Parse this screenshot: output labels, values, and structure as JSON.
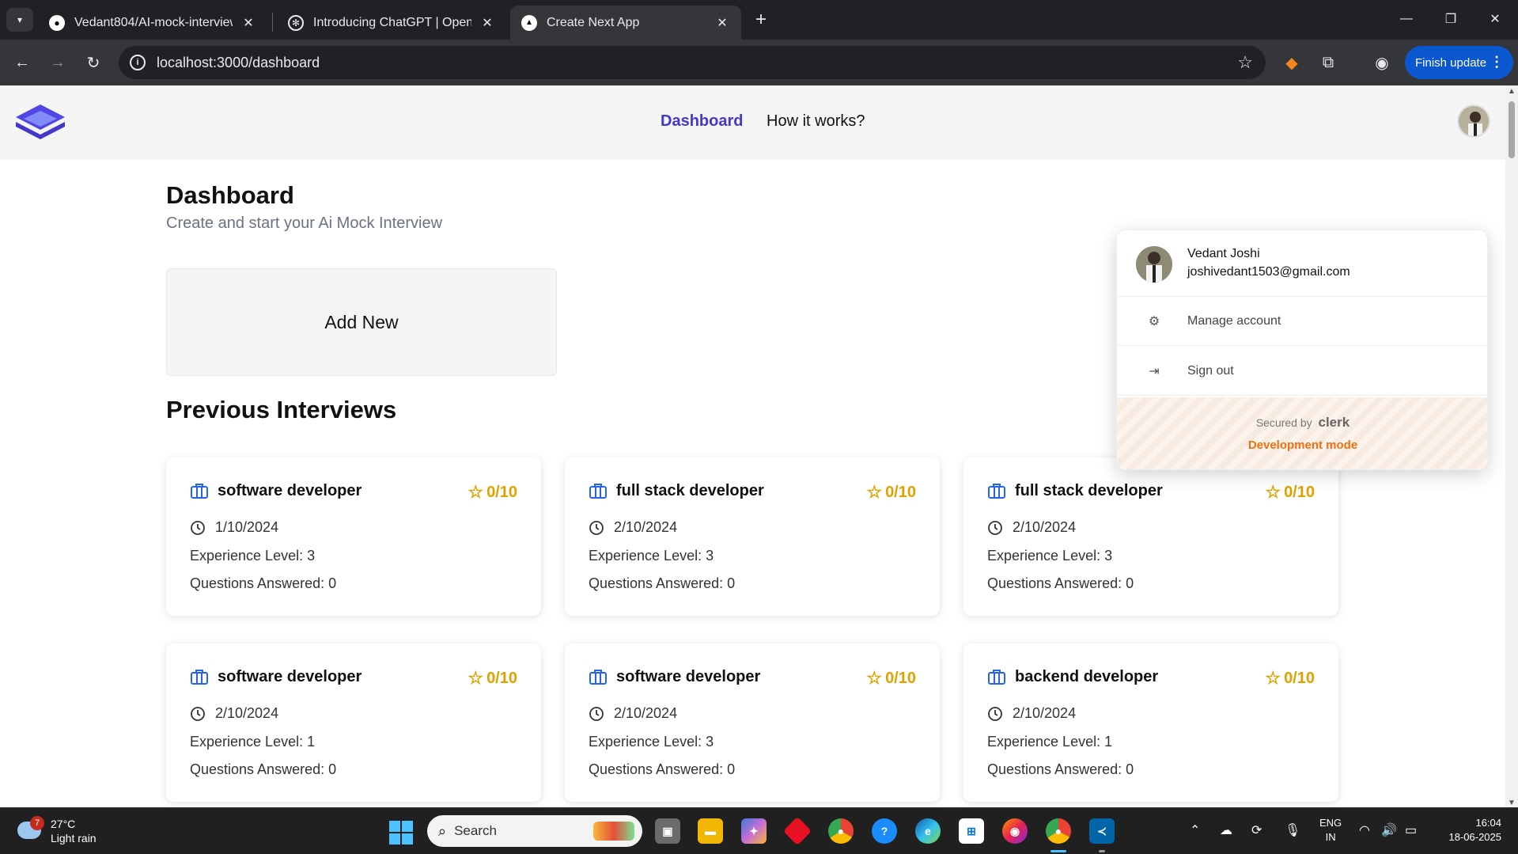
{
  "browser": {
    "tabs": [
      {
        "title": "Vedant804/AI-mock-interview-w",
        "favicon": "github-icon"
      },
      {
        "title": "Introducing ChatGPT | OpenAI",
        "favicon": "openai-icon"
      },
      {
        "title": "Create Next App",
        "favicon": "nextjs-icon",
        "active": true
      }
    ],
    "url": "localhost:3000/dashboard",
    "finish_update": "Finish update"
  },
  "header": {
    "nav": [
      "Dashboard",
      "How it works?"
    ],
    "active_nav": "Dashboard"
  },
  "dashboard": {
    "title": "Dashboard",
    "subtitle": "Create and start your Ai Mock Interview",
    "add_new": "Add New",
    "previous_title": "Previous Interviews"
  },
  "interviews": [
    {
      "role": "software developer",
      "rating": "0/10",
      "date": "1/10/2024",
      "experience": "Experience Level: 3",
      "answered": "Questions Answered: 0"
    },
    {
      "role": "full stack developer",
      "rating": "0/10",
      "date": "2/10/2024",
      "experience": "Experience Level: 3",
      "answered": "Questions Answered: 0"
    },
    {
      "role": "full stack developer",
      "rating": "0/10",
      "date": "2/10/2024",
      "experience": "Experience Level: 3",
      "answered": "Questions Answered: 0"
    },
    {
      "role": "software developer",
      "rating": "0/10",
      "date": "2/10/2024",
      "experience": "Experience Level: 1",
      "answered": "Questions Answered: 0"
    },
    {
      "role": "software developer",
      "rating": "0/10",
      "date": "2/10/2024",
      "experience": "Experience Level: 3",
      "answered": "Questions Answered: 0"
    },
    {
      "role": "backend developer",
      "rating": "0/10",
      "date": "2/10/2024",
      "experience": "Experience Level: 1",
      "answered": "Questions Answered: 0"
    }
  ],
  "user_menu": {
    "name": "Vedant Joshi",
    "email": "joshivedant1503@gmail.com",
    "manage": "Manage account",
    "signout": "Sign out",
    "secured_by": "Secured by",
    "brand": "clerk",
    "dev_mode": "Development mode"
  },
  "taskbar": {
    "weather_temp": "27°C",
    "weather_cond": "Light rain",
    "weather_badge": "7",
    "search": "Search",
    "lang_1": "ENG",
    "lang_2": "IN",
    "time": "16:04",
    "date": "18-06-2025"
  },
  "colors": {
    "accent": "#4338ca",
    "rating": "#e0a200",
    "dev_mode": "#f0700f",
    "update_button": "#0b57d0"
  }
}
